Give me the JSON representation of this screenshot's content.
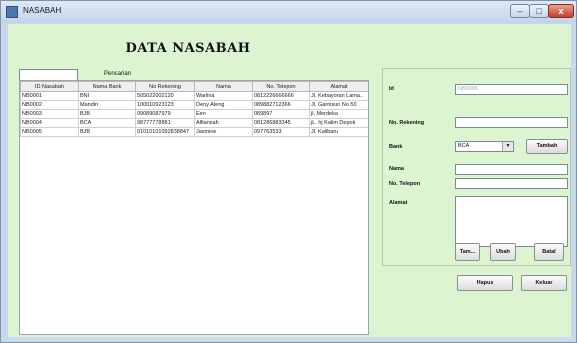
{
  "window": {
    "title": "NASABAH",
    "minimize_label": "–",
    "maximize_label": "□",
    "close_label": "x"
  },
  "header": {
    "title": "DATA NASABAH"
  },
  "search": {
    "label": "Pencarian",
    "value": ""
  },
  "table": {
    "columns": [
      "ID Nasabah",
      "Nama Bank",
      "No Rekening",
      "Nama",
      "No. Telepon",
      "Alamat"
    ],
    "rows": [
      [
        "NB0001",
        "BNI",
        "505022002120",
        "Warlina",
        "0812226666666",
        "Jl. Kebayoran Lama.."
      ],
      [
        "NB0002",
        "Mandiri",
        "100010923123",
        "Deny Ateng",
        "089882712366",
        "Jl. Garnisun No 50"
      ],
      [
        "NB0003",
        "BJB",
        "09089087979",
        "Een",
        "089897",
        "jl. Merdeka"
      ],
      [
        "NB0004",
        "BCA",
        "98777778881",
        "Alfiansah",
        "081286883345",
        "jL. hj Kalim Depok"
      ],
      [
        "NB0005",
        "BJB",
        "01010101092838847",
        "Jasmine",
        "097763533",
        "Jl. Kalibaru"
      ]
    ]
  },
  "form": {
    "id_label": "Id",
    "id_value": "NB0006",
    "rekening_label": "No. Rekening",
    "rekening_value": "",
    "bank_label": "Bank",
    "bank_value": "BCA",
    "tambah_bank_label": "Tambah",
    "nama_label": "Nama",
    "nama_value": "",
    "telepon_label": "No. Telepon",
    "telepon_value": "",
    "alamat_label": "Alamat",
    "alamat_value": ""
  },
  "buttons": {
    "tambah": "Tam...",
    "ubah": "Ubah",
    "batal": "Batal",
    "hapus": "Hapus",
    "keluar": "Keluar"
  },
  "icons": {
    "dropdown": "chevron-down-icon"
  }
}
